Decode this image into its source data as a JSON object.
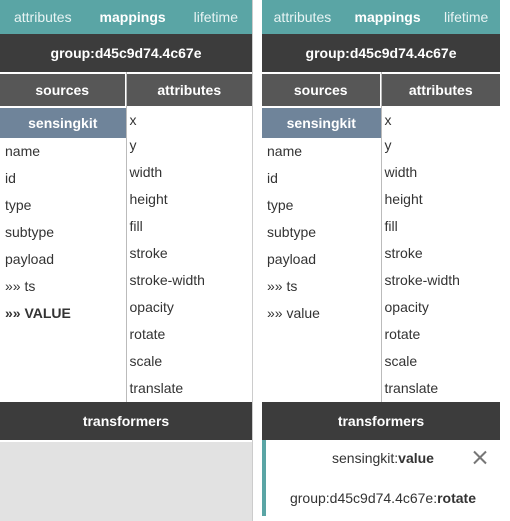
{
  "left": {
    "tabs": [
      "attributes",
      "mappings",
      "lifetime"
    ],
    "group": "group:d45c9d74.4c67e",
    "sources_header": "sources",
    "attributes_header": "attributes",
    "source_name": "sensingkit",
    "source_items": [
      "name",
      "id",
      "type",
      "subtype",
      "payload",
      "»» ts",
      "»» VALUE"
    ],
    "attribute_items": [
      "x",
      "y",
      "width",
      "height",
      "fill",
      "stroke",
      "stroke-width",
      "opacity",
      "rotate",
      "scale",
      "translate"
    ],
    "transformers": "transformers"
  },
  "right": {
    "tabs": [
      "attributes",
      "mappings",
      "lifetime"
    ],
    "group": "group:d45c9d74.4c67e",
    "sources_header": "sources",
    "attributes_header": "attributes",
    "source_name": "sensingkit",
    "source_items": [
      "name",
      "id",
      "type",
      "subtype",
      "payload",
      "»» ts",
      "»» value"
    ],
    "attribute_items": [
      "x",
      "y",
      "width",
      "height",
      "fill",
      "stroke",
      "stroke-width",
      "opacity",
      "rotate",
      "scale",
      "translate"
    ],
    "transformers": "transformers",
    "mapping": {
      "from_prefix": "sensingkit:",
      "from_field": "value",
      "to_prefix": "group:d45c9d74.4c67e:",
      "to_field": "rotate"
    }
  },
  "colors": {
    "teal": "#5aa5a5",
    "dark": "#3c3c3c",
    "mid": "#575757",
    "source": "#6f849a"
  },
  "icons": {
    "close": "close-x-icon"
  }
}
